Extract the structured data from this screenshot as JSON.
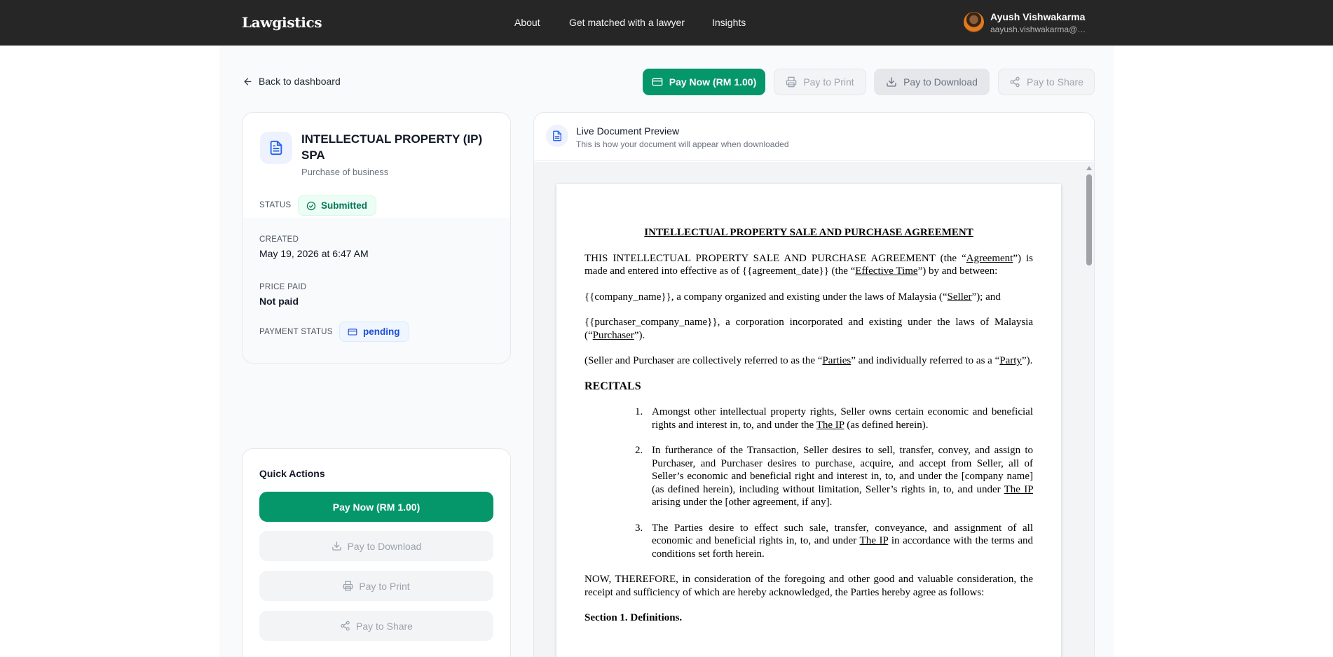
{
  "app": {
    "brand": "Lawgistics",
    "nav": [
      "About",
      "Get matched with a lawyer",
      "Insights"
    ],
    "user": {
      "name": "Ayush Vishwakarma",
      "email": "aayush.vishwakarma@gr..."
    }
  },
  "toolbar": {
    "back_label": "Back to dashboard",
    "pay_now": "Pay Now (RM 1.00)",
    "pay_print": "Pay to Print",
    "pay_download": "Pay to Download",
    "pay_share": "Pay to Share"
  },
  "document": {
    "title": "INTELLECTUAL PROPERTY (IP) SPA",
    "subtitle": "Purchase of business",
    "status_label": "STATUS",
    "status": "Submitted",
    "created_label": "CREATED",
    "created": "May 19, 2026 at 6:47 AM",
    "price_label": "PRICE PAID",
    "price": "Not paid",
    "payment_status_label": "PAYMENT STATUS",
    "payment_status": "pending"
  },
  "quick_actions": {
    "title": "Quick Actions",
    "pay_now": "Pay Now (RM 1.00)",
    "pay_download": "Pay to Download",
    "pay_print": "Pay to Print",
    "pay_share": "Pay to Share"
  },
  "preview": {
    "title": "Live Document Preview",
    "subtitle": "This is how your document will appear when downloaded",
    "doc": {
      "heading": "INTELLECTUAL PROPERTY SALE AND PURCHASE AGREEMENT",
      "intro_a": "THIS INTELLECTUAL PROPERTY SALE AND PURCHASE AGREEMENT (the “",
      "intro_agreement": "Agreement",
      "intro_b": "”) is made and entered into effective as of {{agreement_date}} (the “",
      "intro_eff": "Effective Time",
      "intro_c": "”) by and between:",
      "seller_a": "{{company_name}}, a company organized and existing under the laws of Malaysia (“",
      "seller_u": "Seller",
      "seller_b": "”); and",
      "purchaser_a": "{{purchaser_company_name}}, a corporation incorporated and existing under the laws of Malaysia (“",
      "purchaser_u": "Purchaser",
      "purchaser_b": "”).",
      "parties_a": "(Seller and Purchaser are collectively referred to as the “",
      "parties_u": "Parties",
      "parties_b": "” and individually referred to as a “",
      "party_u": "Party",
      "parties_c": "”).",
      "recitals": "RECITALS",
      "r1_num": "1.",
      "r1_a": "Amongst other intellectual property rights, Seller owns certain economic and beneficial rights and interest in, to, and under the ",
      "r1_u": "The IP",
      "r1_b": " (as defined herein).",
      "r2_num": "2.",
      "r2_a": "In furtherance of the Transaction, Seller desires to sell, transfer, convey, and assign to Purchaser, and Purchaser desires to purchase, acquire, and accept from Seller, all of Seller’s economic and beneficial right and interest in, to, and under the [company name] (as defined herein), including without limitation, Seller’s rights in, to, and under ",
      "r2_u": "The IP",
      "r2_b": " arising under the [other agreement, if any].",
      "r3_num": "3.",
      "r3_a": "The Parties desire to effect such sale, transfer, conveyance, and assignment of all economic and beneficial rights in, to, and under ",
      "r3_u": "The IP",
      "r3_b": " in accordance with the terms and conditions set forth herein.",
      "now_therefore": "NOW, THEREFORE, in consideration of the foregoing and other good and valuable consideration, the receipt and sufficiency of which are hereby acknowledged, the Parties hereby agree as follows:",
      "section1": "Section 1.  Definitions."
    }
  },
  "colors": {
    "topbar": "#262626",
    "primary": "#059669",
    "status_green": "#047857",
    "pending_blue": "#1d4ed8"
  },
  "icons": [
    "arrow-left-icon",
    "credit-card-icon",
    "printer-icon",
    "download-icon",
    "share-icon",
    "document-icon",
    "check-circle-icon"
  ]
}
